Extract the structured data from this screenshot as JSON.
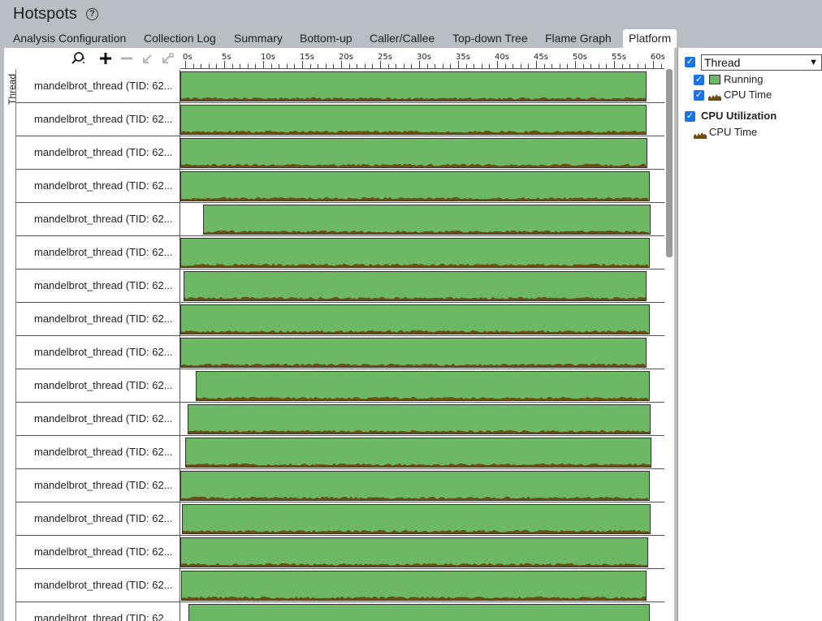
{
  "header": {
    "title": "Hotspots",
    "help_icon": "question-circle-icon"
  },
  "tabs": [
    {
      "label": "Analysis Configuration",
      "active": false
    },
    {
      "label": "Collection Log",
      "active": false
    },
    {
      "label": "Summary",
      "active": false
    },
    {
      "label": "Bottom-up",
      "active": false
    },
    {
      "label": "Caller/Callee",
      "active": false
    },
    {
      "label": "Top-down Tree",
      "active": false
    },
    {
      "label": "Flame Graph",
      "active": false
    },
    {
      "label": "Platform",
      "active": true
    }
  ],
  "toolbar": {
    "icons": [
      "zoom-search-icon",
      "plus-icon",
      "minus-icon",
      "zoom-out-arrow-icon",
      "reset-zoom-icon"
    ]
  },
  "timeline": {
    "ticks": [
      "0s",
      "5s",
      "10s",
      "15s",
      "20s",
      "25s",
      "30s",
      "35s",
      "40s",
      "45s",
      "50s",
      "55s",
      "60s"
    ],
    "side_label": "Thread",
    "max_seconds": 62
  },
  "threads": [
    {
      "name": "mandelbrot_thread (TID: 62...",
      "start": 0.0,
      "end": 59.8
    },
    {
      "name": "mandelbrot_thread (TID: 62...",
      "start": 0.0,
      "end": 59.8
    },
    {
      "name": "mandelbrot_thread (TID: 62...",
      "start": 0.0,
      "end": 59.9
    },
    {
      "name": "mandelbrot_thread (TID: 62...",
      "start": 0.0,
      "end": 60.2
    },
    {
      "name": "mandelbrot_thread (TID: 62...",
      "start": 2.9,
      "end": 60.3
    },
    {
      "name": "mandelbrot_thread (TID: 62...",
      "start": 0.0,
      "end": 60.2
    },
    {
      "name": "mandelbrot_thread (TID: 62...",
      "start": 0.4,
      "end": 59.8
    },
    {
      "name": "mandelbrot_thread (TID: 62...",
      "start": 0.0,
      "end": 60.2
    },
    {
      "name": "mandelbrot_thread (TID: 62...",
      "start": 0.0,
      "end": 59.8
    },
    {
      "name": "mandelbrot_thread (TID: 62...",
      "start": 2.0,
      "end": 60.2
    },
    {
      "name": "mandelbrot_thread (TID: 62...",
      "start": 0.9,
      "end": 60.3
    },
    {
      "name": "mandelbrot_thread (TID: 62...",
      "start": 0.6,
      "end": 60.4
    },
    {
      "name": "mandelbrot_thread (TID: 62...",
      "start": 0.0,
      "end": 60.2
    },
    {
      "name": "mandelbrot_thread (TID: 62...",
      "start": 0.2,
      "end": 60.3
    },
    {
      "name": "mandelbrot_thread (TID: 62...",
      "start": 0.0,
      "end": 60.0
    },
    {
      "name": "mandelbrot_thread (TID: 62...",
      "start": 0.1,
      "end": 59.8
    },
    {
      "name": "mandelbrot_thread (TID: 62...",
      "start": 1.0,
      "end": 60.2
    }
  ],
  "legend": {
    "thread_select": "Thread",
    "thread_items": [
      "Running",
      "CPU Time"
    ],
    "cpu_header": "CPU Utilization",
    "cpu_items": [
      "CPU Time"
    ]
  },
  "colors": {
    "running": "#6cb865",
    "cpu_time": "#6b4e16",
    "checkbox": "#1a73e8"
  }
}
